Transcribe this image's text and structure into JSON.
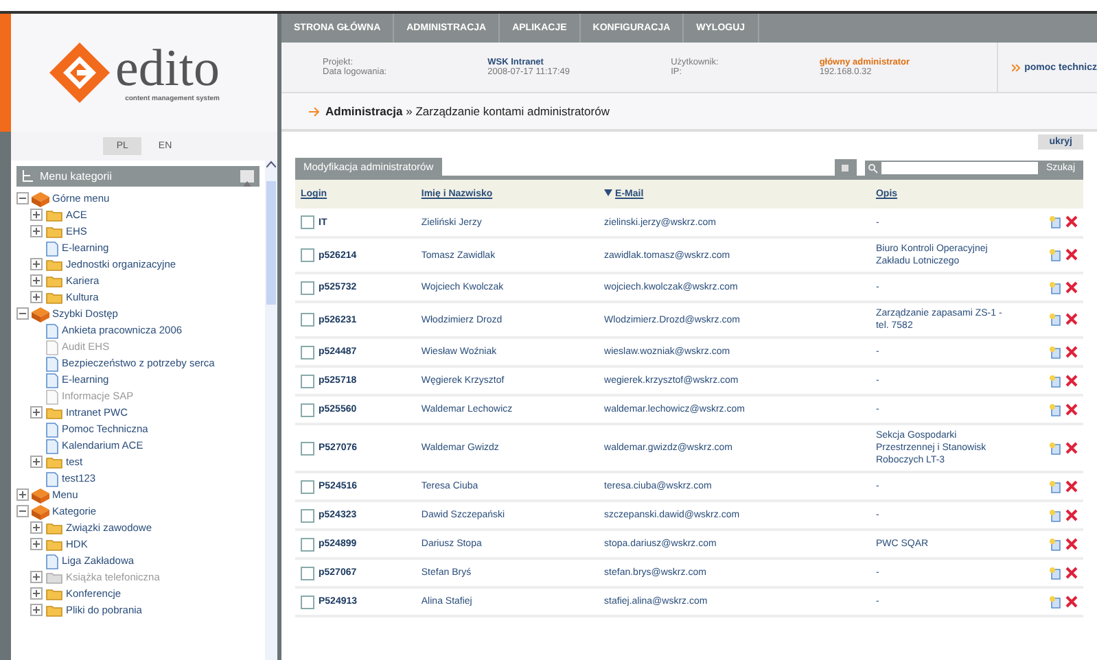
{
  "logo": {
    "name": "edito",
    "tagline": "content management system"
  },
  "languages": [
    {
      "label": "PL",
      "selected": true
    },
    {
      "label": "EN",
      "selected": false
    }
  ],
  "sidebar": {
    "title": "Menu kategorii",
    "tree": [
      {
        "label": "Górne menu",
        "kind": "root",
        "expanded": true,
        "disabled": false,
        "children": [
          {
            "label": "ACE",
            "kind": "folder",
            "expanded": false,
            "disabled": false
          },
          {
            "label": "EHS",
            "kind": "folder",
            "expanded": false,
            "disabled": false
          },
          {
            "label": "E-learning",
            "kind": "page",
            "disabled": false
          },
          {
            "label": "Jednostki organizacyjne",
            "kind": "folder",
            "expanded": false,
            "disabled": false
          },
          {
            "label": "Kariera",
            "kind": "folder",
            "expanded": false,
            "disabled": false
          },
          {
            "label": "Kultura",
            "kind": "folder",
            "expanded": false,
            "disabled": false
          }
        ]
      },
      {
        "label": "Szybki Dostęp",
        "kind": "root",
        "expanded": true,
        "disabled": false,
        "children": [
          {
            "label": "Ankieta pracownicza 2006",
            "kind": "page",
            "disabled": false
          },
          {
            "label": "Audit EHS",
            "kind": "page",
            "disabled": true
          },
          {
            "label": "Bezpieczeństwo z potrzeby serca",
            "kind": "page",
            "disabled": false
          },
          {
            "label": "E-learning",
            "kind": "page",
            "disabled": false
          },
          {
            "label": "Informacje SAP",
            "kind": "page",
            "disabled": true
          },
          {
            "label": "Intranet PWC",
            "kind": "folder",
            "expanded": false,
            "disabled": false
          },
          {
            "label": "Pomoc Techniczna",
            "kind": "page",
            "disabled": false
          },
          {
            "label": "Kalendarium ACE",
            "kind": "page",
            "disabled": false
          },
          {
            "label": "test",
            "kind": "folder",
            "expanded": false,
            "disabled": false
          },
          {
            "label": "test123",
            "kind": "page",
            "disabled": false
          }
        ]
      },
      {
        "label": "Menu",
        "kind": "root",
        "expanded": false,
        "disabled": false
      },
      {
        "label": "Kategorie",
        "kind": "root",
        "expanded": true,
        "disabled": false,
        "children": [
          {
            "label": "Związki zawodowe",
            "kind": "folder",
            "expanded": false,
            "disabled": false
          },
          {
            "label": "HDK",
            "kind": "folder",
            "expanded": false,
            "disabled": false
          },
          {
            "label": "Liga Zakładowa",
            "kind": "page",
            "disabled": false
          },
          {
            "label": "Książka telefoniczna",
            "kind": "folder",
            "expanded": false,
            "disabled": true
          },
          {
            "label": "Konferencje",
            "kind": "folder",
            "expanded": false,
            "disabled": false
          },
          {
            "label": "Pliki do pobrania",
            "kind": "folder",
            "expanded": false,
            "disabled": false
          }
        ]
      }
    ]
  },
  "nav": [
    "STRONA GŁÓWNA",
    "ADMINISTRACJA",
    "APLIKACJE",
    "KONFIGURACJA",
    "WYLOGUJ"
  ],
  "header": {
    "project_label": "Projekt:",
    "project": "WSK Intranet",
    "login_date_label": "Data logowania:",
    "login_date": "2008-07-17 11:17:49",
    "user_label": "Użytkownik:",
    "user": "główny administrator",
    "ip_label": "IP:",
    "ip": "192.168.0.32",
    "help_link": "pomoc technicz"
  },
  "breadcrumb": {
    "section": "Administracja",
    "separator": "»",
    "page": "Zarządzanie kontami administratorów"
  },
  "hide_button": "ukryj",
  "panel_tab": "Modyfikacja administratorów",
  "search": {
    "button": "Szukaj"
  },
  "table": {
    "columns": [
      {
        "label": "Login",
        "sorted": false
      },
      {
        "label": "Imię i Nazwisko",
        "sorted": false
      },
      {
        "label": "E-Mail",
        "sorted": true
      },
      {
        "label": "Opis",
        "sorted": false
      }
    ],
    "rows": [
      {
        "login": "IT",
        "name": "Zieliński Jerzy",
        "email": "zielinski.jerzy@wskrz.com",
        "description": "-",
        "checked": false
      },
      {
        "login": "p526214",
        "name": "Tomasz Zawidlak",
        "email": "zawidlak.tomasz@wskrz.com",
        "description": "Biuro Kontroli Operacyjnej Zakładu Lotniczego",
        "checked": false
      },
      {
        "login": "p525732",
        "name": "Wojciech Kwolczak",
        "email": "wojciech.kwolczak@wskrz.com",
        "description": "-",
        "checked": false
      },
      {
        "login": "p526231",
        "name": "Włodzimierz Drozd",
        "email": "Wlodzimierz.Drozd@wskrz.com",
        "description": "Zarządzanie zapasami ZS-1 - tel. 7582",
        "checked": false
      },
      {
        "login": "p524487",
        "name": "Wiesław Woźniak",
        "email": "wieslaw.wozniak@wskrz.com",
        "description": "-",
        "checked": false
      },
      {
        "login": "p525718",
        "name": "Węgierek Krzysztof",
        "email": "wegierek.krzysztof@wskrz.com",
        "description": "-",
        "checked": false
      },
      {
        "login": "p525560",
        "name": "Waldemar Lechowicz",
        "email": "waldemar.lechowicz@wskrz.com",
        "description": "-",
        "checked": false
      },
      {
        "login": "P527076",
        "name": "Waldemar Gwizdz",
        "email": "waldemar.gwizdz@wskrz.com",
        "description": "Sekcja Gospodarki Przestrzennej i Stanowisk Roboczych LT-3",
        "checked": false
      },
      {
        "login": "P524516",
        "name": "Teresa Ciuba",
        "email": "teresa.ciuba@wskrz.com",
        "description": "-",
        "checked": false
      },
      {
        "login": "p524323",
        "name": "Dawid Szczepański",
        "email": "szczepanski.dawid@wskrz.com",
        "description": "-",
        "checked": false
      },
      {
        "login": "p524899",
        "name": "Dariusz Stopa",
        "email": "stopa.dariusz@wskrz.com",
        "description": "PWC SQAR",
        "checked": false
      },
      {
        "login": "p527067",
        "name": "Stefan Bryś",
        "email": "stefan.brys@wskrz.com",
        "description": "-",
        "checked": false
      },
      {
        "login": "P524913",
        "name": "Alina Stafiej",
        "email": "stafiej.alina@wskrz.com",
        "description": "-",
        "checked": false
      }
    ]
  }
}
